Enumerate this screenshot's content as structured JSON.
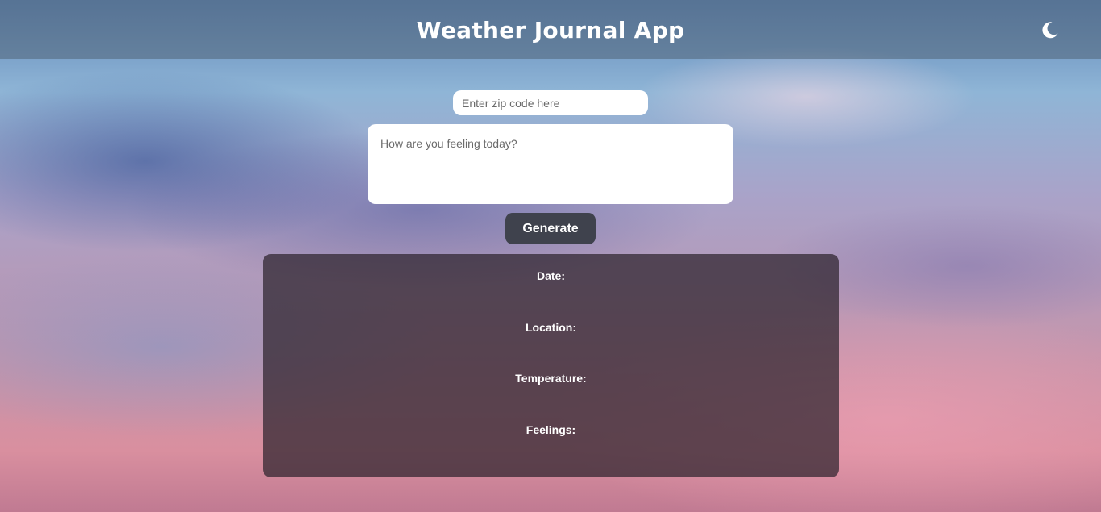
{
  "header": {
    "title": "Weather Journal App",
    "theme_toggle_icon": "moon-icon"
  },
  "form": {
    "zip_placeholder": "Enter zip code here",
    "zip_value": "",
    "feelings_placeholder": "How are you feeling today?",
    "feelings_value": "",
    "generate_label": "Generate"
  },
  "entry": {
    "date_label": "Date:",
    "location_label": "Location:",
    "temperature_label": "Temperature:",
    "feelings_label": "Feelings:"
  },
  "colors": {
    "header_bg": "#50647c",
    "button_bg": "#3f424d",
    "panel_bg": "#2d232d",
    "text": "#ffffff"
  }
}
